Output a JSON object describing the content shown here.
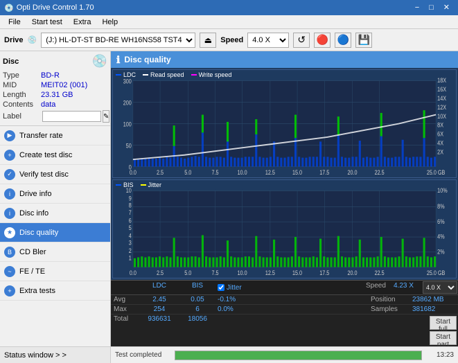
{
  "titlebar": {
    "title": "Opti Drive Control 1.70",
    "icon": "💿",
    "buttons": {
      "minimize": "−",
      "maximize": "□",
      "close": "✕"
    }
  },
  "menubar": {
    "items": [
      "File",
      "Start test",
      "Extra",
      "Help"
    ]
  },
  "drive_toolbar": {
    "drive_label": "Drive",
    "drive_icon": "💿",
    "drive_value": "(J:)  HL-DT-ST BD-RE  WH16NS58 TST4",
    "eject_icon": "⏏",
    "speed_label": "Speed",
    "speed_value": "4.0 X",
    "refresh_icon": "↺",
    "icon1": "🔴",
    "icon2": "🔵",
    "save_icon": "💾"
  },
  "disc": {
    "disc_icon": "💿",
    "type_label": "Type",
    "type_value": "BD-R",
    "mid_label": "MID",
    "mid_value": "MEIT02 (001)",
    "length_label": "Length",
    "length_value": "23.31 GB",
    "contents_label": "Contents",
    "contents_value": "data",
    "label_label": "Label",
    "label_value": ""
  },
  "sidebar": {
    "items": [
      {
        "id": "transfer-rate",
        "label": "Transfer rate",
        "active": false
      },
      {
        "id": "create-test-disc",
        "label": "Create test disc",
        "active": false
      },
      {
        "id": "verify-test-disc",
        "label": "Verify test disc",
        "active": false
      },
      {
        "id": "drive-info",
        "label": "Drive info",
        "active": false
      },
      {
        "id": "disc-info",
        "label": "Disc info",
        "active": false
      },
      {
        "id": "disc-quality",
        "label": "Disc quality",
        "active": true
      },
      {
        "id": "cd-bler",
        "label": "CD Bler",
        "active": false
      },
      {
        "id": "fe-te",
        "label": "FE / TE",
        "active": false
      },
      {
        "id": "extra-tests",
        "label": "Extra tests",
        "active": false
      }
    ],
    "status_window": "Status window > >"
  },
  "quality_panel": {
    "title": "Disc quality",
    "icon": "ℹ",
    "legend": {
      "ldc": {
        "label": "LDC",
        "color": "#0044ff"
      },
      "read_speed": {
        "label": "Read speed",
        "color": "#ffffff"
      },
      "write_speed": {
        "label": "Write speed",
        "color": "#ff00ff"
      }
    },
    "legend2": {
      "bis": {
        "label": "BIS",
        "color": "#0044ff"
      },
      "jitter": {
        "label": "Jitter",
        "color": "#ffff00"
      }
    }
  },
  "chart_upper": {
    "y_left": [
      "300",
      "200",
      "100",
      "50",
      "0"
    ],
    "y_right": [
      "18X",
      "16X",
      "14X",
      "12X",
      "10X",
      "8X",
      "6X",
      "4X",
      "2X"
    ],
    "x_labels": [
      "0.0",
      "2.5",
      "5.0",
      "7.5",
      "10.0",
      "12.5",
      "15.0",
      "17.5",
      "20.0",
      "22.5",
      "25.0 GB"
    ]
  },
  "chart_lower": {
    "y_left": [
      "10",
      "9",
      "8",
      "7",
      "6",
      "5",
      "4",
      "3",
      "2",
      "1"
    ],
    "y_right": [
      "10%",
      "8%",
      "6%",
      "4%",
      "2%"
    ],
    "x_labels": [
      "0.0",
      "2.5",
      "5.0",
      "7.5",
      "10.0",
      "12.5",
      "15.0",
      "17.5",
      "20.0",
      "22.5",
      "25.0 GB"
    ]
  },
  "stats": {
    "headers": [
      "LDC",
      "BIS",
      "",
      "Jitter",
      "Speed",
      "4.23 X",
      "4.0 X"
    ],
    "avg_label": "Avg",
    "avg_ldc": "2.45",
    "avg_bis": "0.05",
    "avg_jitter": "-0.1%",
    "max_label": "Max",
    "max_ldc": "254",
    "max_bis": "6",
    "max_jitter": "0.0%",
    "total_label": "Total",
    "total_ldc": "936631",
    "total_bis": "18056",
    "position_label": "Position",
    "position_value": "23862 MB",
    "samples_label": "Samples",
    "samples_value": "381682",
    "jitter_checked": true,
    "jitter_label": "Jitter",
    "speed_label": "Speed",
    "speed_value": "4.23 X",
    "speed_select": "4.0 X",
    "start_full": "Start full",
    "start_part": "Start part"
  },
  "progress": {
    "status_label": "Test completed",
    "percent": 100,
    "time": "13:23"
  }
}
